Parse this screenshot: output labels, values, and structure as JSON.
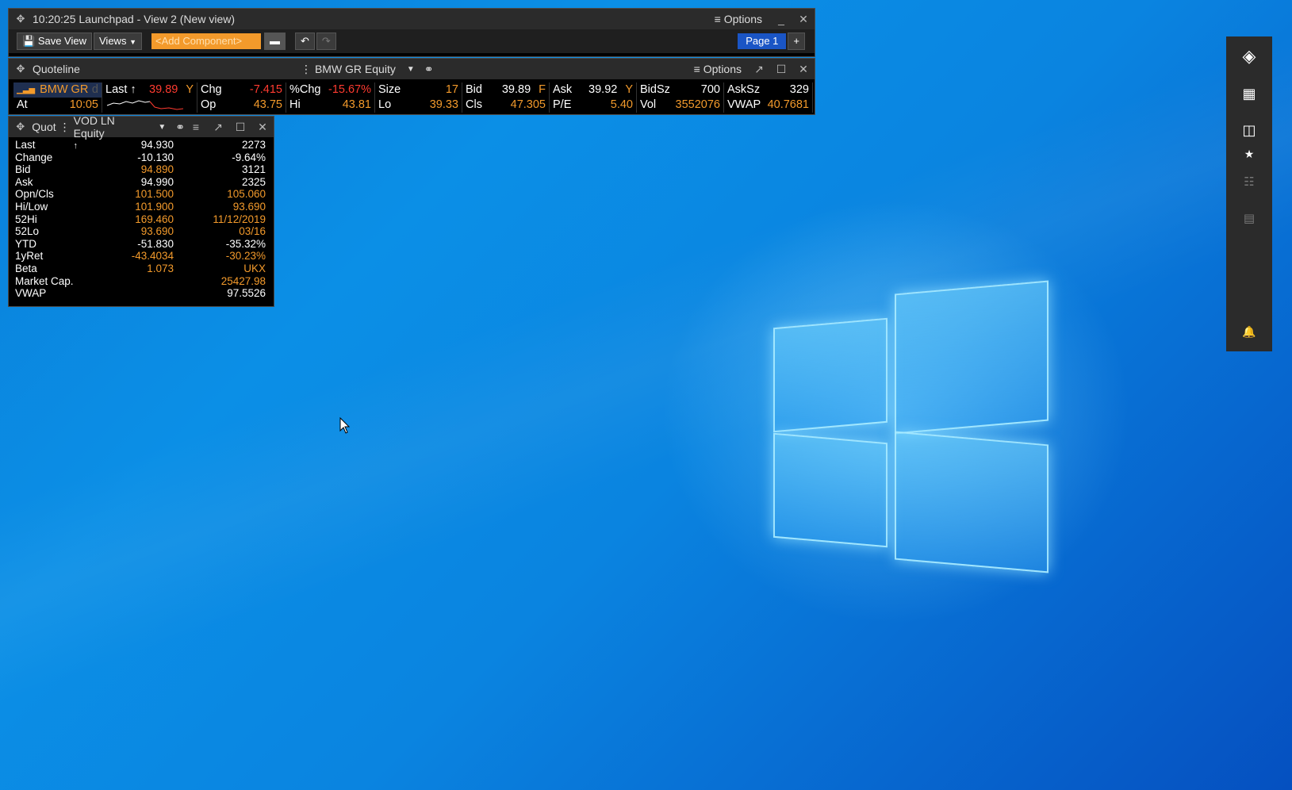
{
  "launchpad": {
    "title": "10:20:25 Launchpad - View 2 (New view)",
    "options_label": "Options",
    "minimize_glyph": "_",
    "close_glyph": "✕",
    "toolbar": {
      "save_view_label": "Save View",
      "views_label": "Views",
      "add_component_placeholder": "<Add Component>",
      "page_label": "Page 1",
      "add_page_glyph": "+"
    }
  },
  "quoteline": {
    "title": "Quoteline",
    "security": "BMW GR Equity",
    "options_label": "Options",
    "row1": [
      {
        "label": "BMW GR",
        "value": "d",
        "label_color": "orange",
        "value_color": "#555"
      },
      {
        "label": "Last ↑",
        "value": "39.89",
        "suffix": "Y",
        "value_color": "red"
      },
      {
        "label": "Chg",
        "value": "-7.415",
        "value_color": "red"
      },
      {
        "label": "%Chg",
        "value": "-15.67%",
        "value_color": "red"
      },
      {
        "label": "Size",
        "value": "17",
        "value_color": "orange"
      },
      {
        "label": "Bid",
        "value": "39.89",
        "suffix": "F",
        "value_color": "white"
      },
      {
        "label": "Ask",
        "value": "39.92",
        "suffix": "Y",
        "value_color": "white"
      },
      {
        "label": "BidSz",
        "value": "700",
        "value_color": "white"
      },
      {
        "label": "AskSz",
        "value": "329",
        "value_color": "white"
      }
    ],
    "row2": [
      {
        "label": "At",
        "value": "10:05",
        "value_color": "orange"
      },
      {
        "label": "",
        "value": "",
        "value_color": "white"
      },
      {
        "label": "Op",
        "value": "43.75",
        "value_color": "orange"
      },
      {
        "label": "Hi",
        "value": "43.81",
        "value_color": "orange"
      },
      {
        "label": "Lo",
        "value": "39.33",
        "value_color": "orange"
      },
      {
        "label": "Cls",
        "value": "47.305",
        "value_color": "orange"
      },
      {
        "label": "P/E",
        "value": "5.40",
        "value_color": "orange"
      },
      {
        "label": "Vol",
        "value": "3552076",
        "value_color": "orange"
      },
      {
        "label": "VWAP",
        "value": "40.7681",
        "value_color": "orange"
      }
    ]
  },
  "quote": {
    "title_prefix": "Quot",
    "security": "VOD LN Equity",
    "rows": [
      {
        "label": "Last",
        "mark": "↑",
        "a": "94.930",
        "b": "2273",
        "ac": "white",
        "bc": "white"
      },
      {
        "label": "Change",
        "a": "-10.130",
        "b": "-9.64%",
        "ac": "white",
        "bc": "white"
      },
      {
        "label": "Bid",
        "a": "94.890",
        "b": "3121",
        "ac": "orange",
        "bc": "white"
      },
      {
        "label": "Ask",
        "a": "94.990",
        "b": "2325",
        "ac": "white",
        "bc": "white"
      },
      {
        "label": "Opn/Cls",
        "a": "101.500",
        "b": "105.060",
        "ac": "orange",
        "bc": "orange"
      },
      {
        "label": "Hi/Low",
        "a": "101.900",
        "b": "93.690",
        "ac": "orange",
        "bc": "orange"
      },
      {
        "label": "52Hi",
        "a": "169.460",
        "b": "11/12/2019",
        "ac": "orange",
        "bc": "orange"
      },
      {
        "label": "52Lo",
        "a": "93.690",
        "b": "03/16",
        "ac": "orange",
        "bc": "orange"
      },
      {
        "label": "YTD",
        "a": "-51.830",
        "b": "-35.32%",
        "ac": "white",
        "bc": "white"
      },
      {
        "label": "1yRet",
        "a": "-43.4034",
        "b": "-30.23%",
        "ac": "orange",
        "bc": "orange"
      },
      {
        "label": "Beta",
        "a": "1.073",
        "b": "UKX",
        "ac": "orange",
        "bc": "orange"
      },
      {
        "label": "Market Cap.",
        "a": "",
        "b": "25427.98",
        "ac": "orange",
        "bc": "orange"
      },
      {
        "label": "VWAP",
        "a": "",
        "b": "97.5526",
        "ac": "white",
        "bc": "white"
      }
    ]
  },
  "sidebar": {
    "icons": [
      "bloomberg-logo-icon",
      "grid-icon",
      "layout-icon",
      "star-icon",
      "list-icon",
      "news-icon",
      "bell-icon"
    ]
  },
  "colors": {
    "orange": "#f39a2b",
    "red": "#ff3b30",
    "accent_blue": "#1a55c5"
  }
}
